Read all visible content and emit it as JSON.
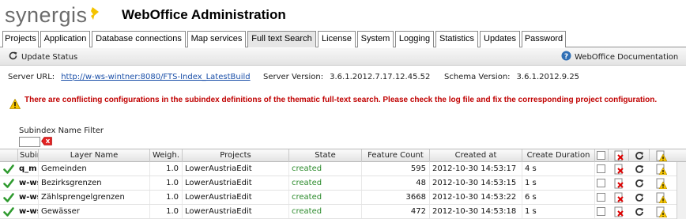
{
  "header": {
    "logo_text": "synergis",
    "title": "WebOffice Administration"
  },
  "tabs": [
    {
      "label": "Projects"
    },
    {
      "label": "Application"
    },
    {
      "label": "Database connections"
    },
    {
      "label": "Map services"
    },
    {
      "label": "Full text Search",
      "active": true
    },
    {
      "label": "License"
    },
    {
      "label": "System"
    },
    {
      "label": "Logging"
    },
    {
      "label": "Statistics"
    },
    {
      "label": "Updates"
    },
    {
      "label": "Password"
    }
  ],
  "toolbar": {
    "update_status_label": "Update Status",
    "documentation_label": "WebOffice Documentation"
  },
  "info": {
    "server_url_label": "Server URL:",
    "server_url": "http://w-ws-wintner:8080/FTS-Index_LatestBuild",
    "server_version_label": "Server Version:",
    "server_version": "3.6.1.2012.7.17.12.45.52",
    "schema_version_label": "Schema Version:",
    "schema_version": "3.6.1.2012.9.25"
  },
  "warning": {
    "text": "There are conflicting configurations in the subindex definitions of the thematic full-text search. Please check the log file and fix the corresponding project configuration."
  },
  "filter": {
    "label": "Subindex Name Filter",
    "value": ""
  },
  "grid": {
    "columns": {
      "subindex": "Subin",
      "layer_name": "Layer Name",
      "weight": "Weigh.",
      "projects": "Projects",
      "state": "State",
      "feature_count": "Feature Count",
      "created_at": "Created at",
      "create_duration": "Create Duration"
    },
    "rows": [
      {
        "subindex": "q_m",
        "layer_name": "Gemeinden",
        "weight": "1.0",
        "projects": "LowerAustriaEdit",
        "state": "created",
        "feature_count": "595",
        "created_at": "2012-10-30 14:53:17",
        "create_duration": "4 s"
      },
      {
        "subindex": "w-ws",
        "layer_name": "Bezirksgrenzen",
        "weight": "1.0",
        "projects": "LowerAustriaEdit",
        "state": "created",
        "feature_count": "48",
        "created_at": "2012-10-30 14:53:15",
        "create_duration": "1 s"
      },
      {
        "subindex": "w-ws",
        "layer_name": "Zählsprengelgrenzen",
        "weight": "1.0",
        "projects": "LowerAustriaEdit",
        "state": "created",
        "feature_count": "3668",
        "created_at": "2012-10-30 14:53:22",
        "create_duration": "6 s"
      },
      {
        "subindex": "w-ws",
        "layer_name": "Gewässer",
        "weight": "1.0",
        "projects": "LowerAustriaEdit",
        "state": "created",
        "feature_count": "472",
        "created_at": "2012-10-30 14:53:18",
        "create_duration": "1 s"
      }
    ]
  },
  "colors": {
    "warning_text": "#c00000",
    "state_created": "#2b8a2b",
    "link": "#1a4fa8",
    "logo_accent": "#f4c300"
  }
}
